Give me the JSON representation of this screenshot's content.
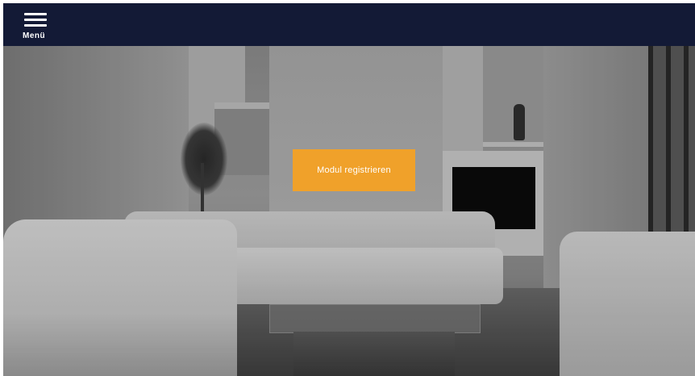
{
  "header": {
    "menu_label": "Menü",
    "menu_icon": "hamburger-menu-icon",
    "background_color": "#131a36"
  },
  "hero": {
    "image": "living-room-photo",
    "cta_label": "Modul registrieren",
    "cta_color": "#f0a12a"
  }
}
